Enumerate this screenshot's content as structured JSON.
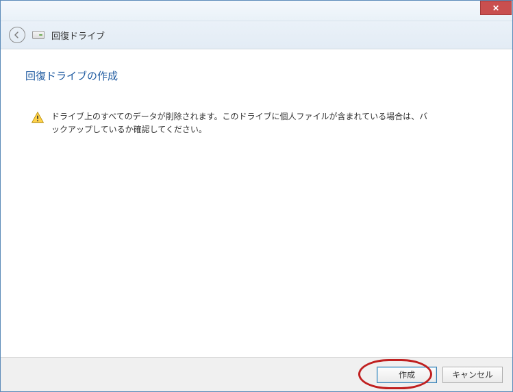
{
  "window": {
    "close_label": "✕"
  },
  "header": {
    "title": "回復ドライブ"
  },
  "main": {
    "page_title": "回復ドライブの作成",
    "warning_text": "ドライブ上のすべてのデータが削除されます。このドライブに個人ファイルが含まれている場合は、バックアップしているか確認してください。"
  },
  "footer": {
    "primary_label": "作成",
    "cancel_label": "キャンセル"
  }
}
